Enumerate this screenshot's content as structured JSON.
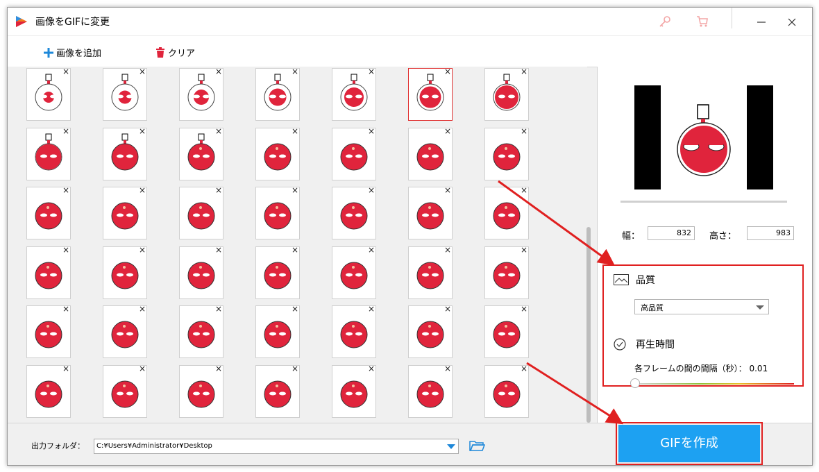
{
  "window": {
    "title": "画像をGIFに変更"
  },
  "titlebar": {
    "icons": [
      "key-icon",
      "cart-icon",
      "minimize-icon",
      "close-icon"
    ]
  },
  "toolbar": {
    "add_label": "画像を追加",
    "clear_label": "クリア"
  },
  "grid": {
    "columns": 7,
    "rows": 6,
    "remove_glyph": "×",
    "selected_index": 5
  },
  "preview": {
    "width_label": "幅：",
    "width_value": "832",
    "height_label": "高さ：",
    "height_value": "983"
  },
  "settings": {
    "quality_title": "品質",
    "quality_value": "高品質",
    "playback_title": "再生時間",
    "interval_label": "各フレームの間の間隔（秒）：",
    "interval_value": "0.01"
  },
  "bottom": {
    "output_label": "出力フォルダ：",
    "output_path": "C:¥Users¥Administrator¥Desktop",
    "create_label": "GIFを作成"
  },
  "colors": {
    "accent": "#1da1f2",
    "highlight": "#e02020",
    "ball": "#e0243c"
  }
}
